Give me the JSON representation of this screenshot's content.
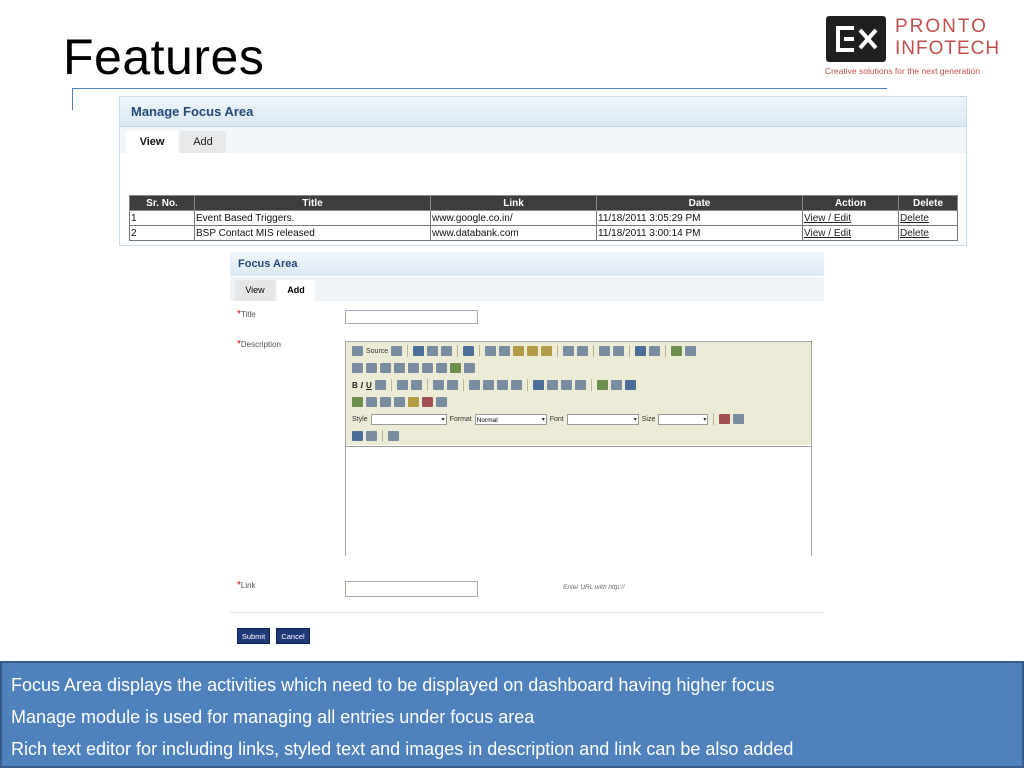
{
  "slide": {
    "title": "Features"
  },
  "logo": {
    "line1": "PRONTO",
    "line2": "INFOTECH",
    "tagline": "Creative solutions for the next generation",
    "accent_color": "#c0504d"
  },
  "manage_panel": {
    "title": "Manage Focus Area",
    "tabs": [
      {
        "label": "View",
        "active": true
      },
      {
        "label": "Add",
        "active": false
      }
    ],
    "table": {
      "headers": [
        "Sr. No.",
        "Title",
        "Link",
        "Date",
        "Action",
        "Delete"
      ],
      "rows": [
        {
          "sr": "1",
          "title": "Event Based Triggers.",
          "link": "www.google.co.in/",
          "date": "11/18/2011 3:05:29 PM",
          "action": "View / Edit",
          "delete": "Delete"
        },
        {
          "sr": "2",
          "title": "BSP Contact MIS released",
          "link": "www.databank.com",
          "date": "11/18/2011 3:00:14 PM",
          "action": "View / Edit",
          "delete": "Delete"
        }
      ]
    }
  },
  "form_panel": {
    "title": "Focus Area",
    "tabs": [
      {
        "label": "View",
        "active": false
      },
      {
        "label": "Add",
        "active": true
      }
    ],
    "required_mark": "*",
    "fields": {
      "title_label": "Title",
      "title_value": "",
      "description_label": "Description",
      "link_label": "Link",
      "link_value": "",
      "link_hint": "Enter URL with http://"
    },
    "editor": {
      "source_label": "Source",
      "style_label": "Style",
      "format_label": "Format",
      "format_value": "Normal",
      "font_label": "Font",
      "size_label": "Size",
      "bold": "B",
      "italic": "I",
      "underline": "U"
    },
    "buttons": {
      "submit": "Submit",
      "cancel": "Cancel"
    }
  },
  "caption": {
    "lines": [
      "Focus Area displays the activities which need to be displayed on dashboard having higher focus",
      "Manage module is used for managing all entries under focus area",
      "Rich text editor for including links, styled text and images in description and link can be also added"
    ],
    "background_color": "#4f81bd"
  }
}
